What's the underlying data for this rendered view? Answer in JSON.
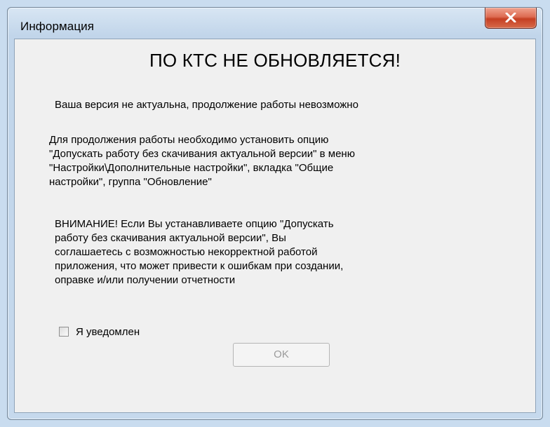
{
  "window": {
    "title": "Информация"
  },
  "message": {
    "heading": "ПО КТС НЕ ОБНОВЛЯЕТСЯ!",
    "paragraph1": "Ваша версия не актуальна, продолжение работы невозможно",
    "paragraph2_lines": [
      "Для продолжения работы необходимо установить опцию",
      "\"Допускать работу без скачивания актуальной версии\" в меню",
      "\"Настройки\\Дополнительные настройки\", вкладка \"Общие",
      "настройки\", группа \"Обновление\""
    ],
    "paragraph3_lines": [
      "ВНИМАНИЕ! Если Вы устанавливаете опцию \"Допускать",
      "работу без скачивания актуальной версии\", Вы",
      "соглашаетесь с возможностью некорректной работой",
      "приложения, что может привести к ошибкам при создании,",
      "оправке и/или получении отчетности"
    ]
  },
  "checkbox": {
    "label": "Я уведомлен",
    "checked": false
  },
  "buttons": {
    "ok_label": "OK",
    "ok_enabled": false
  },
  "icons": {
    "close": "close-icon"
  },
  "colors": {
    "close_button": "#c53f22",
    "dialog_background": "#f0f0f0"
  }
}
